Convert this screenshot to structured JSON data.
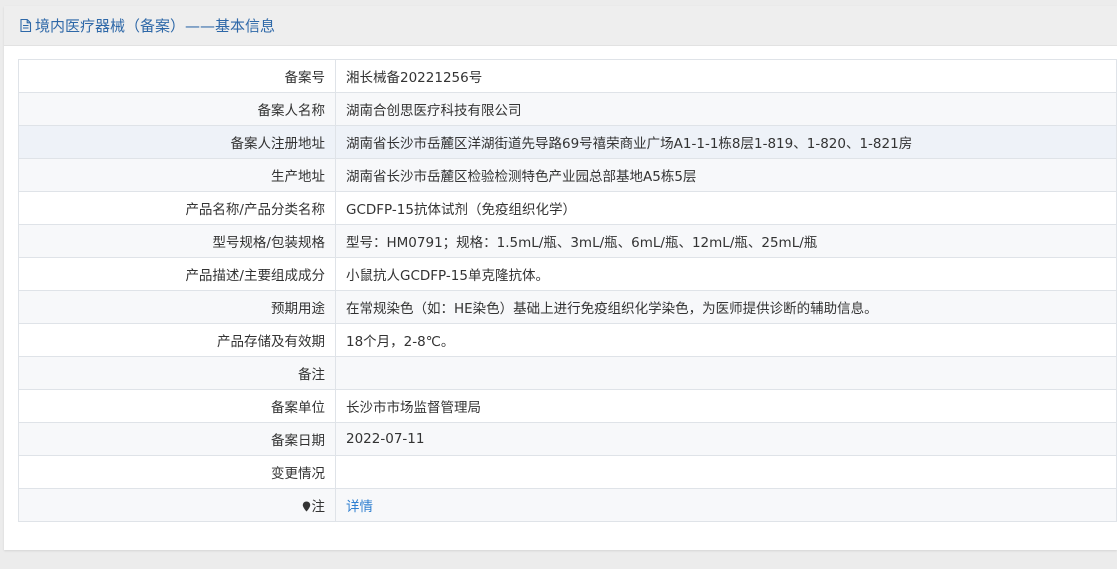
{
  "header": {
    "title": "境内医疗器械（备案）——基本信息",
    "icon": "document-icon"
  },
  "colors": {
    "title": "#2e68a8",
    "link": "#2f7fd0"
  },
  "rows": [
    {
      "label": "备案号",
      "value": "湘长械备20221256号"
    },
    {
      "label": "备案人名称",
      "value": "湖南合创思医疗科技有限公司"
    },
    {
      "label": "备案人注册地址",
      "value": "湖南省长沙市岳麓区洋湖街道先导路69号禧荣商业广场A1-1-1栋8层1-819、1-820、1-821房"
    },
    {
      "label": "生产地址",
      "value": "湖南省长沙市岳麓区检验检测特色产业园总部基地A5栋5层"
    },
    {
      "label": "产品名称/产品分类名称",
      "value": "GCDFP-15抗体试剂（免疫组织化学）"
    },
    {
      "label": "型号规格/包装规格",
      "value": "型号：HM0791；规格：1.5mL/瓶、3mL/瓶、6mL/瓶、12mL/瓶、25mL/瓶"
    },
    {
      "label": "产品描述/主要组成成分",
      "value": "小鼠抗人GCDFP-15单克隆抗体。"
    },
    {
      "label": "预期用途",
      "value": "在常规染色（如：HE染色）基础上进行免疫组织化学染色，为医师提供诊断的辅助信息。"
    },
    {
      "label": "产品存储及有效期",
      "value": "18个月，2-8℃。"
    },
    {
      "label": "备注",
      "value": ""
    },
    {
      "label": "备案单位",
      "value": "长沙市市场监督管理局"
    },
    {
      "label": "备案日期",
      "value": "2022-07-11"
    },
    {
      "label": "变更情况",
      "value": ""
    }
  ],
  "note_row": {
    "label": "注",
    "icon": "pin-icon",
    "link_text": "详情"
  }
}
